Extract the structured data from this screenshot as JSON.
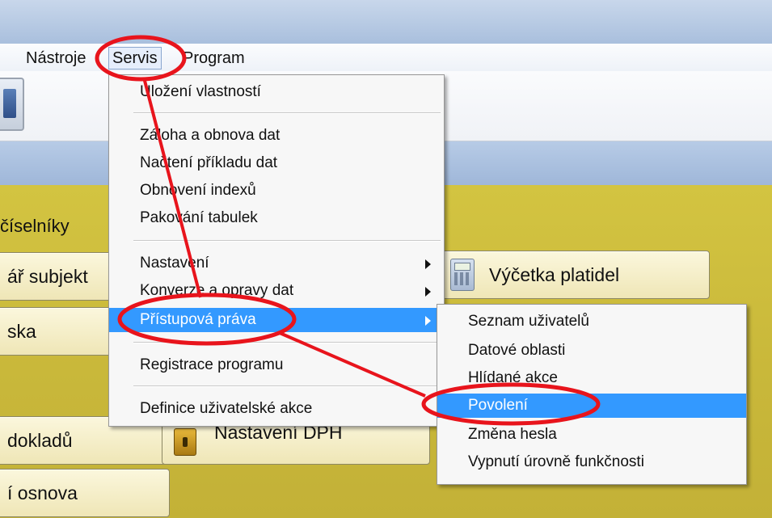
{
  "menubar": {
    "items": [
      {
        "label": "Nástroje"
      },
      {
        "label": "Servis"
      },
      {
        "label": "Program"
      }
    ]
  },
  "main": {
    "section_label": "číselníky",
    "buttons": {
      "adresar": "ář subjekt",
      "kniha": "ska",
      "vycetka": "Výčetka platidel",
      "dokladu": "dokladů",
      "dph": "Nastavení DPH",
      "osnova": "í osnova"
    }
  },
  "servis_menu": {
    "items": [
      {
        "label": "Uložení vlastností"
      },
      {
        "label": "Záloha a obnova dat"
      },
      {
        "label": "Načtení příkladu dat"
      },
      {
        "label": "Obnovení indexů"
      },
      {
        "label": "Pakování tabulek"
      },
      {
        "label": "Nastavení",
        "has_submenu": true
      },
      {
        "label": "Konverze a opravy dat",
        "has_submenu": true
      },
      {
        "label": "Přístupová práva",
        "has_submenu": true,
        "highlighted": true
      },
      {
        "label": "Registrace programu"
      },
      {
        "label": "Definice uživatelské akce"
      }
    ]
  },
  "pristupova_prava_submenu": {
    "items": [
      {
        "label": "Seznam uživatelů"
      },
      {
        "label": "Datové oblasti"
      },
      {
        "label": "Hlídané akce"
      },
      {
        "label": "Povolení",
        "highlighted": true
      },
      {
        "label": "Změna hesla"
      },
      {
        "label": "Vypnutí úrovně funkčnosti"
      }
    ]
  },
  "colors": {
    "menu_highlight": "#3399ff",
    "annotation_red": "#e8141c",
    "main_background": "#cbbb3a"
  },
  "icons": [
    "toolbar-icon",
    "calculator-icon",
    "lock-icon",
    "submenu-arrow-icon"
  ]
}
